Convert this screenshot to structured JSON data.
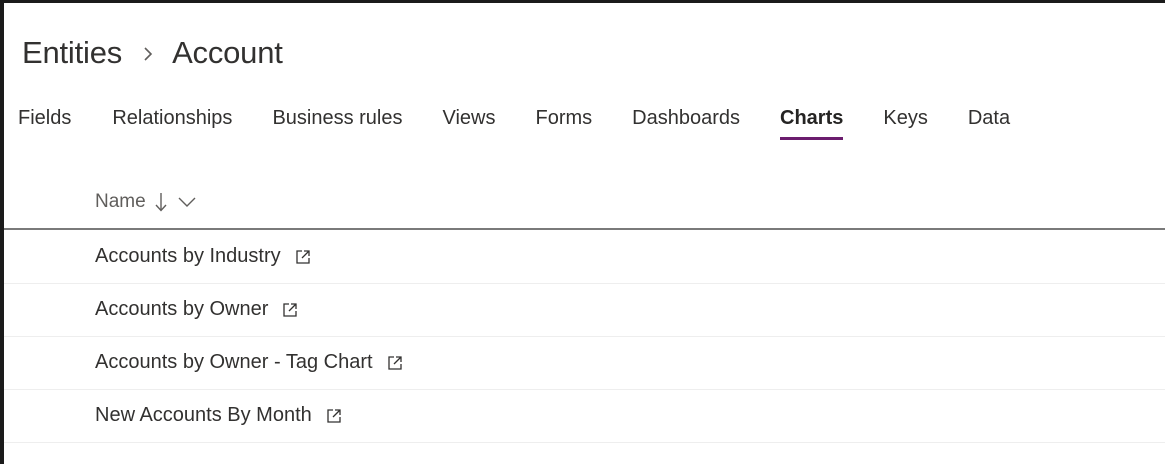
{
  "breadcrumb": {
    "parent": "Entities",
    "current": "Account"
  },
  "tabs": [
    {
      "label": "Fields",
      "active": false
    },
    {
      "label": "Relationships",
      "active": false
    },
    {
      "label": "Business rules",
      "active": false
    },
    {
      "label": "Views",
      "active": false
    },
    {
      "label": "Forms",
      "active": false
    },
    {
      "label": "Dashboards",
      "active": false
    },
    {
      "label": "Charts",
      "active": true
    },
    {
      "label": "Keys",
      "active": false
    },
    {
      "label": "Data",
      "active": false
    }
  ],
  "table": {
    "column_name": "Name",
    "sort_icon": "arrow-down-icon",
    "menu_icon": "chevron-down-icon",
    "rows": [
      {
        "name": "Accounts by Industry",
        "icon": "open-in-new-window-icon"
      },
      {
        "name": "Accounts by Owner",
        "icon": "open-in-new-window-icon"
      },
      {
        "name": "Accounts by Owner - Tag Chart",
        "icon": "open-in-new-window-icon"
      },
      {
        "name": "New Accounts By Month",
        "icon": "open-in-new-window-icon"
      }
    ]
  },
  "colors": {
    "active_tab_underline": "#6b1d6e",
    "text": "#323130",
    "muted_text": "#605e5c"
  }
}
